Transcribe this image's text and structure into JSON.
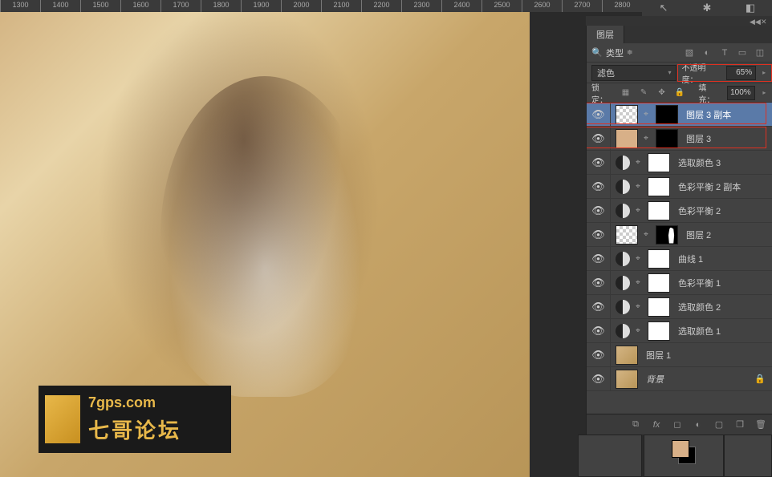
{
  "ruler": {
    "ticks": [
      "1300",
      "1400",
      "1500",
      "1600",
      "1700",
      "1800",
      "1900",
      "2000",
      "2100",
      "2200",
      "2300",
      "2400",
      "2500",
      "2600",
      "2700",
      "2800"
    ]
  },
  "watermark": {
    "line1": "7gps.com",
    "line2": "七哥论坛"
  },
  "panel": {
    "tab": "图层",
    "filter": {
      "label": "类型"
    },
    "blend": {
      "mode": "滤色",
      "opacity_label": "不透明度：",
      "opacity_value": "65%",
      "lock_label": "锁定：",
      "fill_label": "填充：",
      "fill_value": "100%"
    }
  },
  "layers": [
    {
      "name": "图层 3 副本",
      "thumb": "trans",
      "mask": "mask-b",
      "hl": true,
      "sel": true
    },
    {
      "name": "图层 3",
      "thumb": "peach",
      "mask": "mask-b",
      "hl": true
    },
    {
      "name": "选取颜色 3",
      "adj": true,
      "thumb": "white"
    },
    {
      "name": "色彩平衡 2 副本",
      "adj": true,
      "thumb": "white"
    },
    {
      "name": "色彩平衡 2",
      "adj": true,
      "thumb": "white"
    },
    {
      "name": "图层 2",
      "thumb": "trans",
      "mask": "mask-sil"
    },
    {
      "name": "曲线 1",
      "adj": true,
      "thumb": "white"
    },
    {
      "name": "色彩平衡 1",
      "adj": true,
      "thumb": "white"
    },
    {
      "name": "选取颜色 2",
      "adj": true,
      "thumb": "white"
    },
    {
      "name": "选取颜色 1",
      "adj": true,
      "thumb": "white"
    },
    {
      "name": "图层 1",
      "thumb": "photo-t"
    },
    {
      "name": "背景",
      "thumb": "photo-t",
      "locked": true,
      "italic": true
    }
  ]
}
